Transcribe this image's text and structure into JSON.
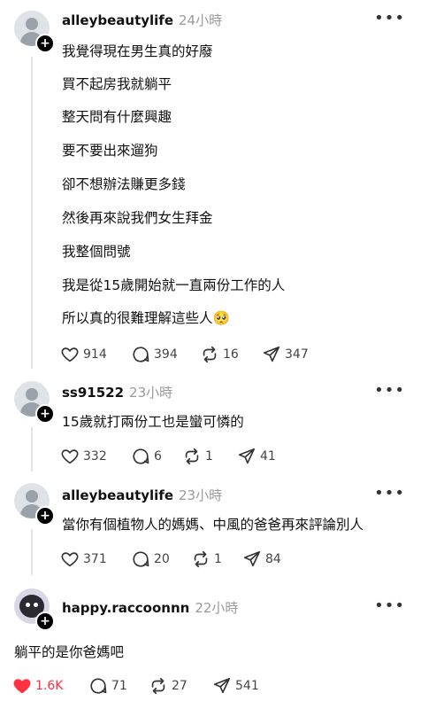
{
  "posts": [
    {
      "username": "alleybeautylife",
      "time": "24小時",
      "lines": [
        "我覺得現在男生真的好廢",
        "買不起房我就躺平",
        "整天問有什麼興趣",
        "要不要出來遛狗",
        "卻不想辦法賺更多錢",
        "然後再來說我們女生拜金",
        "我整個問號",
        "我是從15歲開始就一直兩份工作的人",
        "所以真的很難理解這些人🥺"
      ],
      "likes": "914",
      "comments": "394",
      "reposts": "16",
      "shares": "347"
    },
    {
      "username": "ss91522",
      "time": "23小時",
      "lines": [
        "15歲就打兩份工也是蠻可憐的"
      ],
      "likes": "332",
      "comments": "6",
      "reposts": "1",
      "shares": "41"
    },
    {
      "username": "alleybeautylife",
      "time": "23小時",
      "lines": [
        "當你有個植物人的媽媽、中風的爸爸再來評論別人"
      ],
      "likes": "371",
      "comments": "20",
      "reposts": "1",
      "shares": "84"
    },
    {
      "username": "happy.raccoonnn",
      "time": "22小時",
      "lines": [
        "躺平的是你爸媽吧"
      ],
      "likes": "1.6K",
      "comments": "71",
      "reposts": "27",
      "shares": "541"
    }
  ],
  "icons": {
    "more": "more-dots-icon",
    "like": "heart-icon",
    "comment": "comment-bubble-icon",
    "repost": "repost-icon",
    "share": "send-icon",
    "follow": "plus-icon"
  },
  "colors": {
    "like_active": "#ff3040",
    "muted": "#999999",
    "thread_line": "#e4e4e4"
  }
}
